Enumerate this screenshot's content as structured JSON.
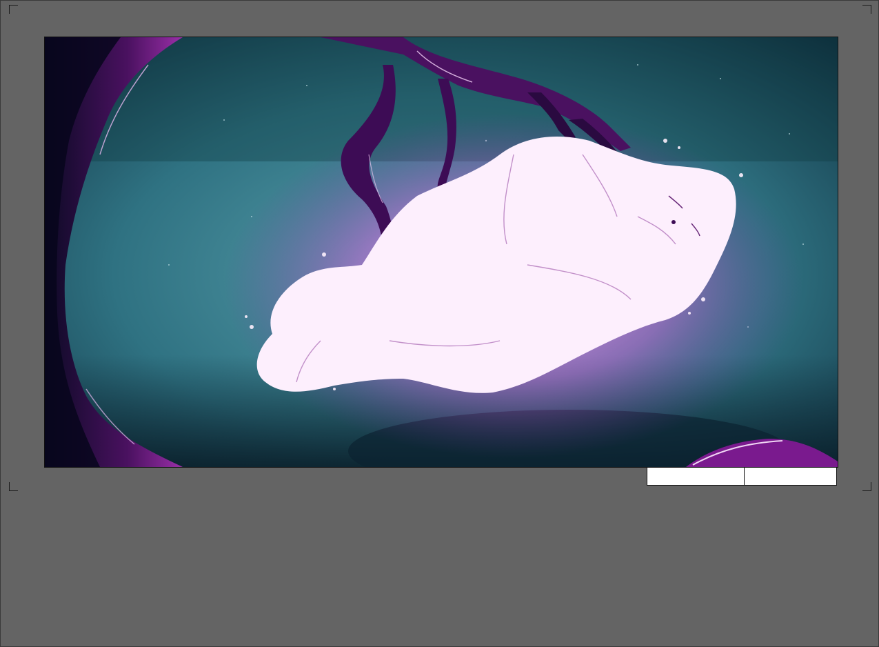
{
  "canvas": {
    "background_color": "#646464",
    "frame_border_color": "#111111"
  },
  "panel": {
    "illustration": "glowing-figure-floating-between-purple-tree-branches",
    "palette": {
      "sky_light": "#4f93a3",
      "sky_dark": "#0f2f40",
      "branch": "#5a1566",
      "branch_highlight": "#e9c6ef",
      "glow": "#d77be0",
      "figure": "#fdeffd"
    }
  },
  "caption_fields": {
    "shot": "",
    "time": ""
  }
}
